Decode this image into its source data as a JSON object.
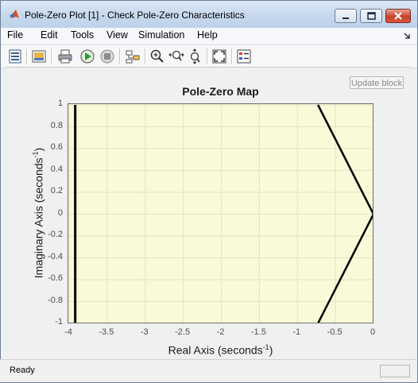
{
  "window": {
    "title": "Pole-Zero Plot [1] - Check Pole-Zero Characteristics"
  },
  "menu": [
    "File",
    "Edit",
    "Tools",
    "View",
    "Simulation",
    "Help"
  ],
  "toolbar": {
    "icons": [
      "block-parameters-icon",
      "print-preview-icon",
      "print-icon",
      "run-icon",
      "stop-icon",
      "highlight-block-icon",
      "zoom-in-icon",
      "zoom-x-icon",
      "zoom-y-icon",
      "fit-view-icon",
      "legend-icon"
    ]
  },
  "update_button": "Update block",
  "status": {
    "text": "Ready"
  },
  "chart_data": {
    "type": "line",
    "title": "Pole-Zero Map",
    "xlabel": "Real Axis (seconds",
    "xlabel_sup": "-1",
    "xlabel_end": ")",
    "ylabel": "Imaginary Axis (seconds",
    "ylabel_sup": "-1",
    "ylabel_end": ")",
    "xlim": [
      -4,
      0
    ],
    "ylim": [
      -1,
      1
    ],
    "xticks": [
      "-4",
      "-3.5",
      "-3",
      "-2.5",
      "-2",
      "-1.5",
      "-1",
      "-0.5",
      "0"
    ],
    "yticks": [
      "1",
      "0.8",
      "0.6",
      "0.4",
      "0.2",
      "0",
      "-0.2",
      "-0.4",
      "-0.6",
      "-0.8",
      "-1"
    ],
    "grid": true,
    "background": "#fafad9",
    "series": [
      {
        "x": [
          -3.92,
          -3.92
        ],
        "y": [
          -1,
          1
        ],
        "color": "#000000",
        "width": 3
      },
      {
        "x": [
          -0.73,
          0,
          -0.73
        ],
        "y": [
          1,
          0,
          -1
        ],
        "color": "#000000",
        "width": 2.5
      }
    ]
  }
}
